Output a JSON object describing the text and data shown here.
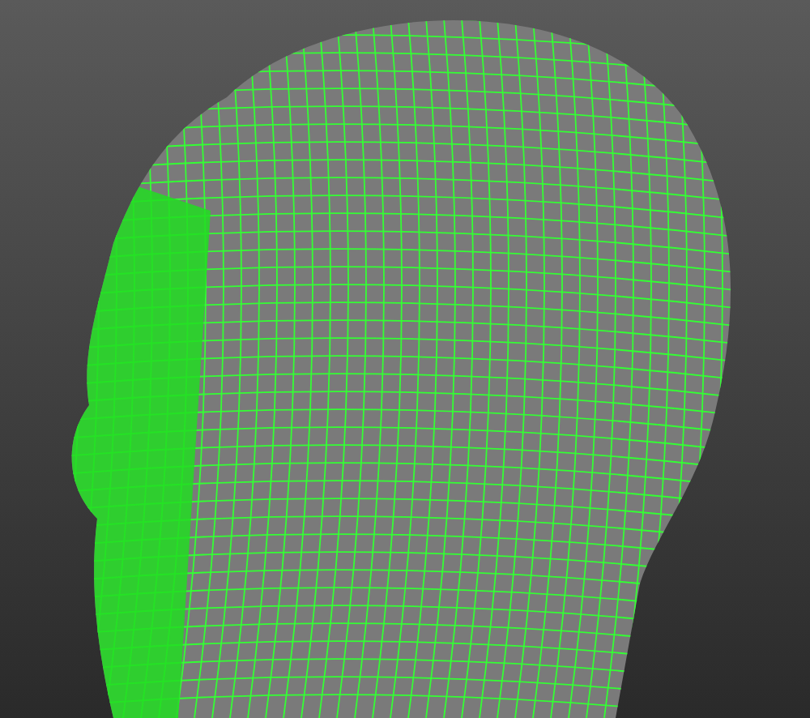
{
  "viewport": {
    "model": {
      "kind": "wireframe"
    }
  }
}
